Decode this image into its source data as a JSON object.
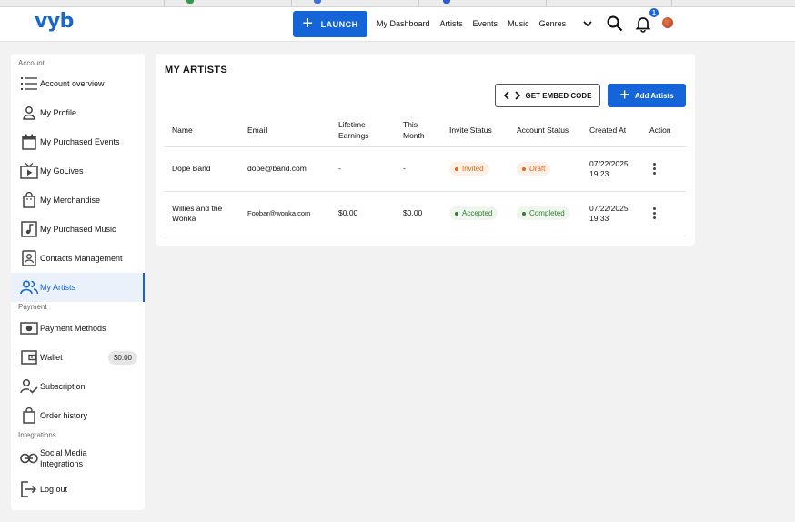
{
  "header": {
    "logo": "vyb",
    "launch_label": "LAUNCH",
    "nav": [
      "My Dashboard",
      "Artists",
      "Events",
      "Music",
      "Genres"
    ],
    "notification_count": "1",
    "brand_color": "#1565d8"
  },
  "sidebar": {
    "sections": {
      "account": "Account",
      "payment": "Payment",
      "integrations": "Integrations"
    },
    "items": [
      {
        "label": "Account overview",
        "icon": "list-icon"
      },
      {
        "label": "My Profile",
        "icon": "person-icon"
      },
      {
        "label": "My Purchased Events",
        "icon": "calendar-icon"
      },
      {
        "label": "My GoLives",
        "icon": "tv-play-icon"
      },
      {
        "label": "My Merchandise",
        "icon": "bag-icon"
      },
      {
        "label": "My Purchased Music",
        "icon": "music-note-icon"
      },
      {
        "label": "Contacts Management",
        "icon": "contact-card-icon"
      },
      {
        "label": "My Artists",
        "icon": "people-icon",
        "active": true
      },
      {
        "label": "Payment Methods",
        "icon": "payment-icon"
      },
      {
        "label": "Wallet",
        "icon": "wallet-icon",
        "badge": "$0.00"
      },
      {
        "label": "Subscription",
        "icon": "subscription-icon"
      },
      {
        "label": "Order history",
        "icon": "shopping-bag-icon"
      },
      {
        "label": "Social Media Integrations",
        "icon": "link-icon"
      },
      {
        "label": "Log out",
        "icon": "logout-icon"
      }
    ]
  },
  "main": {
    "title": "MY ARTISTS",
    "embed_label": "GET EMBED CODE",
    "add_label": "Add Artists",
    "columns": [
      "Name",
      "Email",
      "Lifetime Earnings",
      "This Month",
      "Invite Status",
      "Account Status",
      "Created At",
      "Action"
    ],
    "rows": [
      {
        "name": "Dope Band",
        "email": "dope@band.com",
        "lifetime": "-",
        "month": "-",
        "invite": "Invited",
        "account": "Draft",
        "created": "07/22/2025 19:23"
      },
      {
        "name": "Willies and the Wonka",
        "email": "Foobar@wonka.com",
        "lifetime": "$0.00",
        "month": "$0.00",
        "invite": "Accepted",
        "account": "Completed",
        "created": "07/22/2025 19:33"
      }
    ]
  }
}
